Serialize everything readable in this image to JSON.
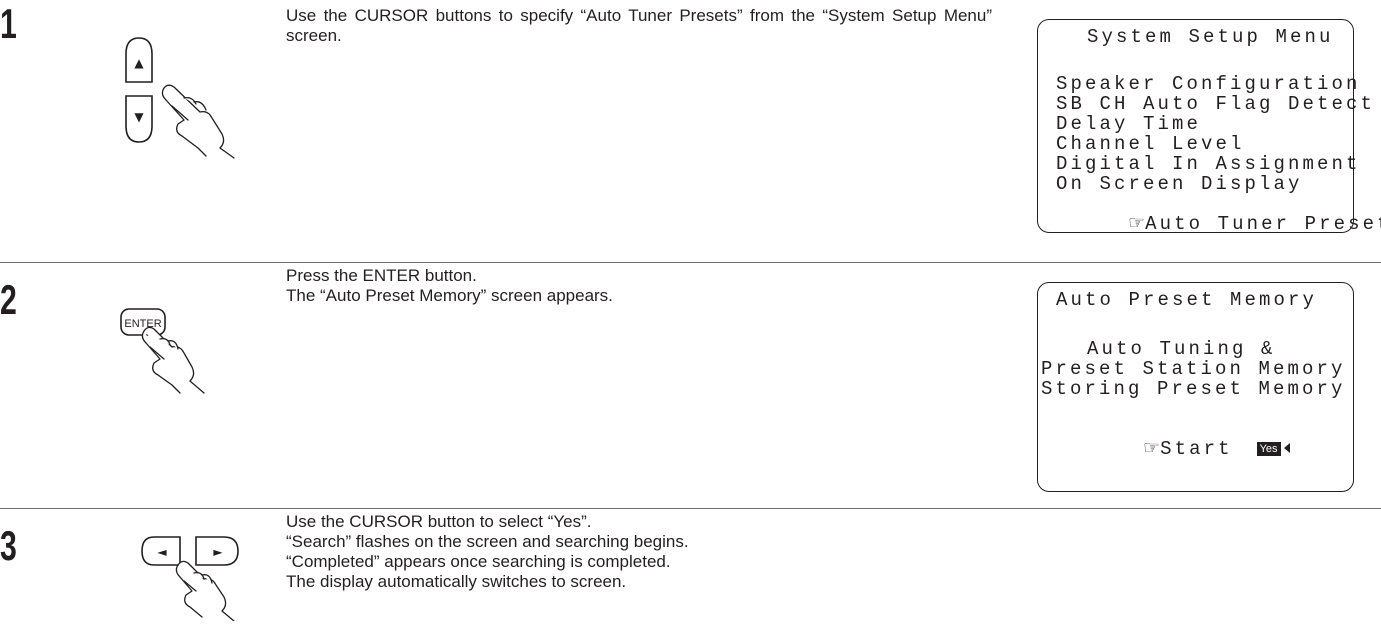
{
  "steps": [
    {
      "number": "1",
      "illustration": {
        "icon": "cursor-up-down-buttons-with-hand",
        "up_glyph": "▲",
        "down_glyph": "▼"
      },
      "description": [
        "Use the CURSOR buttons to specify “Auto Tuner Presets” from the “System Setup Menu” screen."
      ],
      "osd": {
        "title": "System Setup Menu",
        "items": [
          "Speaker Configuration",
          "SB CH Auto Flag Detect",
          "Delay Time",
          "Channel Level",
          "Digital In Assignment",
          "On Screen Display",
          "Auto Tuner Presets"
        ],
        "selected_item": "Auto Tuner Presets",
        "pointer_glyph": "☞"
      }
    },
    {
      "number": "2",
      "illustration": {
        "icon": "enter-button-with-hand",
        "button_label": "ENTER"
      },
      "description": [
        "Press the ENTER button.",
        "The “Auto Preset Memory” screen appears."
      ],
      "osd": {
        "title": "Auto Preset Memory",
        "lines": [
          "Auto Tuning &",
          "Preset Station Memory",
          "Storing Preset Memory"
        ],
        "start_label": "Start",
        "pointer_glyph": "☞",
        "yes_label": "Yes"
      }
    },
    {
      "number": "3",
      "illustration": {
        "icon": "cursor-left-right-buttons-with-hand",
        "left_glyph": "◄",
        "right_glyph": "►"
      },
      "description": [
        "Use the CURSOR button to select “Yes”.",
        "“Search” flashes on the screen and searching begins.",
        "“Completed” appears once searching is completed.",
        "The display automatically switches to screen."
      ]
    }
  ],
  "colors": {
    "ink": "#231f20",
    "divider": "#6d6d6d",
    "background": "#ffffff"
  }
}
